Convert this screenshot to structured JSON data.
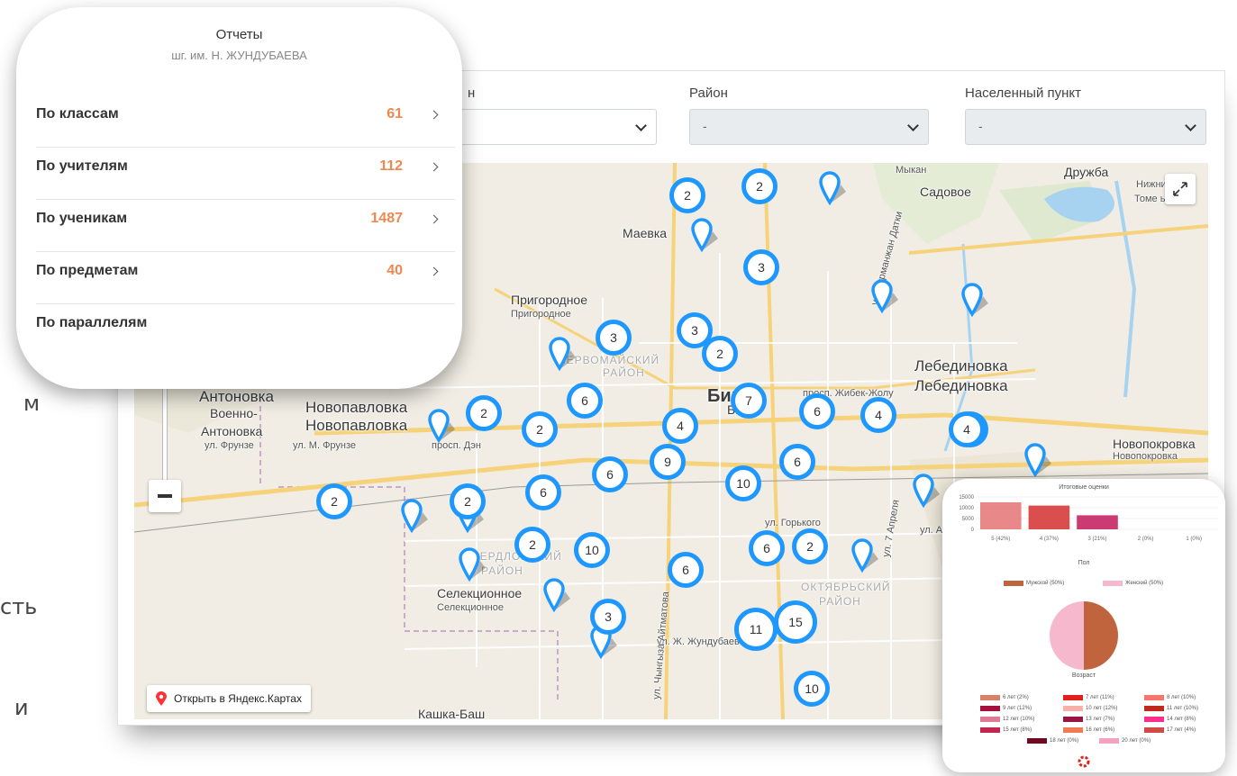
{
  "page_fragments": [
    "м",
    "сть",
    "и"
  ],
  "filters": {
    "col1_label_fragment": "н",
    "district_label": "Район",
    "district_value": "-",
    "settlement_label": "Населенный пункт",
    "settlement_value": "-"
  },
  "reports": {
    "title": "Отчеты",
    "subtitle": "шг. им. Н. ЖУНДУБАЕВА",
    "items": [
      {
        "label": "По классам",
        "count": "61"
      },
      {
        "label": "По учителям",
        "count": "112"
      },
      {
        "label": "По ученикам",
        "count": "1487"
      },
      {
        "label": "По предметам",
        "count": "40"
      },
      {
        "label": "По параллелям",
        "count": ""
      }
    ]
  },
  "map": {
    "open_link": "Открыть в Яндекс.Картах",
    "places": [
      {
        "text": "Мыкан",
        "cls": "small"
      },
      {
        "text": "Дружба",
        "cls": ""
      },
      {
        "text": "Садовое",
        "cls": ""
      },
      {
        "text": "Нижний Нс",
        "cls": "small"
      },
      {
        "text": "Томе   ьо",
        "cls": "small"
      },
      {
        "text": "Маевка",
        "cls": ""
      },
      {
        "text": "Пригородное",
        "cls": ""
      },
      {
        "text": "Пригородное",
        "cls": "small"
      },
      {
        "text": "ПЕРВОМАЙСКИЙ",
        "cls": "district"
      },
      {
        "text": "РАЙОН",
        "cls": "district"
      },
      {
        "text": "Лебединовка",
        "cls": "big"
      },
      {
        "text": "Лебединовка",
        "cls": "big"
      },
      {
        "text": "Антоновка",
        "cls": "big"
      },
      {
        "text": "Военно-",
        "cls": ""
      },
      {
        "text": "Антоновка",
        "cls": ""
      },
      {
        "text": "Новопавловка",
        "cls": "big"
      },
      {
        "text": "Новопавловка",
        "cls": "big"
      },
      {
        "text": "ул. Фрунзе",
        "cls": "small"
      },
      {
        "text": "ул. М. Фрунзе",
        "cls": "small"
      },
      {
        "text": "просп. Дэн",
        "cls": "small"
      },
      {
        "text": "Биш",
        "cls": "bold"
      },
      {
        "text": "Биш",
        "cls": ""
      },
      {
        "text": "просп. Жибек-Жолу",
        "cls": "small"
      },
      {
        "text": "Новопокровка",
        "cls": ""
      },
      {
        "text": "Новопокровка",
        "cls": "small"
      },
      {
        "text": "ул. Горького",
        "cls": "small"
      },
      {
        "text": "ул. Анкара",
        "cls": "small"
      },
      {
        "text": "СВЕРДЛОВСКИЙ",
        "cls": "district"
      },
      {
        "text": "РАЙОН",
        "cls": "district"
      },
      {
        "text": "ОКТЯБРЬСКИЙ",
        "cls": "district"
      },
      {
        "text": "РАЙОН",
        "cls": "district"
      },
      {
        "text": "ул. Ж. Жундубаева",
        "cls": "small"
      },
      {
        "text": "Селекционное",
        "cls": ""
      },
      {
        "text": "Селекционное",
        "cls": "small"
      },
      {
        "text": "Кашка-Баш",
        "cls": ""
      },
      {
        "text": "ул. 7 Апреля",
        "cls": "small"
      },
      {
        "text": "ул. Курманжан Датки",
        "cls": "small"
      },
      {
        "text": "ул. Чынгыза Айтматова",
        "cls": "small"
      }
    ],
    "clusters": [
      "2",
      "2",
      "3",
      "3",
      "3",
      "2",
      "2",
      "6",
      "2",
      "4",
      "7",
      "6",
      "4",
      "3",
      "6",
      "9",
      "6",
      "10",
      "6",
      "2",
      "6",
      "2",
      "2",
      "10",
      "6",
      "3",
      "4",
      "15",
      "11",
      "10",
      "2"
    ]
  },
  "stats": {
    "grades_title": "Итоговые оценки",
    "grades_ticks": [
      "15000",
      "10000",
      "5000",
      "0"
    ],
    "grades_labels": [
      "5 (42%)",
      "4 (37%)",
      "3 (21%)",
      "2 (0%)",
      "1 (0%)"
    ],
    "grades_values": [
      12500,
      11000,
      6500,
      0,
      0
    ],
    "grades_ymax": 15000,
    "grades_colors": [
      "#e57373",
      "#d32f2f",
      "#c2185b",
      "#888888",
      "#888888"
    ],
    "gender_title": "Пол",
    "gender_legend": [
      "Мужской (50%)",
      "Женский (50%)"
    ],
    "gender_colors": [
      "#c0643e",
      "#f5b8cc"
    ],
    "age_title": "Возраст",
    "age_legend": [
      {
        "label": "6 лет (2%)",
        "color": "#d9826a"
      },
      {
        "label": "7 лет (11%)",
        "color": "#e0201b"
      },
      {
        "label": "8 лет (10%)",
        "color": "#f7766b"
      },
      {
        "label": "9 лет (12%)",
        "color": "#a6123f"
      },
      {
        "label": "10 лет (12%)",
        "color": "#f7b1a8"
      },
      {
        "label": "11 лет (10%)",
        "color": "#c02a1c"
      },
      {
        "label": "12 лет (10%)",
        "color": "#e07b95"
      },
      {
        "label": "13 лет (7%)",
        "color": "#9b1544"
      },
      {
        "label": "14 лет (8%)",
        "color": "#ff2d8d"
      },
      {
        "label": "15 лет (8%)",
        "color": "#c2264d"
      },
      {
        "label": "16 лет (6%)",
        "color": "#f27a55"
      },
      {
        "label": "17 лет (4%)",
        "color": "#d14a46"
      },
      {
        "label": "18 лет (0%)",
        "color": "#6e0a22"
      },
      {
        "label": "20 лет (0%)",
        "color": "#f4a3bf"
      }
    ]
  },
  "colors": {
    "accent_orange": "#f0874f",
    "cluster_blue": "#1e98ff"
  }
}
